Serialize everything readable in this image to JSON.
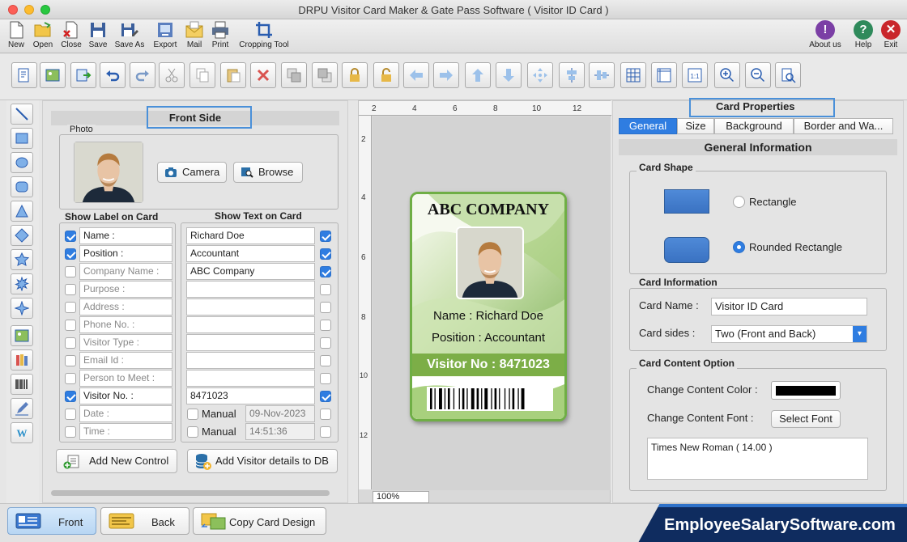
{
  "window": {
    "title": "DRPU Visitor Card Maker & Gate Pass Software ( Visitor ID Card )"
  },
  "toolbar": {
    "new": "New",
    "open": "Open",
    "close": "Close",
    "save": "Save",
    "save_as": "Save As",
    "export": "Export",
    "mail": "Mail",
    "print": "Print",
    "cropping_tool": "Cropping Tool",
    "about_us": "About us",
    "help": "Help",
    "exit": "Exit"
  },
  "front": {
    "title": "Front Side",
    "photo_group": "Photo",
    "camera": "Camera",
    "browse": "Browse",
    "label_header": "Show Label on Card",
    "text_header": "Show Text on Card",
    "rows": [
      {
        "label": "Name :",
        "label_checked": true,
        "text": "Richard Doe",
        "text_checked": true
      },
      {
        "label": "Position :",
        "label_checked": true,
        "text": "Accountant",
        "text_checked": true
      },
      {
        "label": "Company Name :",
        "label_checked": false,
        "text": "ABC Company",
        "text_checked": true
      },
      {
        "label": "Purpose :",
        "label_checked": false,
        "text": "",
        "text_checked": false
      },
      {
        "label": "Address :",
        "label_checked": false,
        "text": "",
        "text_checked": false
      },
      {
        "label": "Phone No. :",
        "label_checked": false,
        "text": "",
        "text_checked": false
      },
      {
        "label": "Visitor Type :",
        "label_checked": false,
        "text": "",
        "text_checked": false
      },
      {
        "label": "Email Id :",
        "label_checked": false,
        "text": "",
        "text_checked": false
      },
      {
        "label": "Person to Meet :",
        "label_checked": false,
        "text": "",
        "text_checked": false
      },
      {
        "label": "Visitor No. :",
        "label_checked": true,
        "text": "8471023",
        "text_checked": true
      }
    ],
    "date_label": "Date :",
    "time_label": "Time :",
    "manual": "Manual",
    "date_value": "09-Nov-2023",
    "time_value": "14:51:36",
    "add_control": "Add New Control",
    "add_visitor_db": "Add Visitor details to DB"
  },
  "canvas": {
    "zoom": "100%",
    "ruler_top": [
      "2",
      "4",
      "6",
      "8",
      "10",
      "12"
    ],
    "ruler_left": [
      "2",
      "4",
      "6",
      "8",
      "10",
      "12"
    ]
  },
  "card": {
    "company": "ABC COMPANY",
    "name_line": "Name : Richard Doe",
    "position_line": "Position :  Accountant",
    "visitor_line": "Visitor No :  8471023",
    "accent": "#7cae47"
  },
  "props": {
    "title": "Card Properties",
    "tabs": [
      "General",
      "Size",
      "Background",
      "Border and Wa..."
    ],
    "general_info": "General Information",
    "card_shape": "Card Shape",
    "rectangle": "Rectangle",
    "rounded_rectangle": "Rounded Rectangle",
    "card_information": "Card Information",
    "card_name_label": "Card Name :",
    "card_name_value": "Visitor ID Card",
    "card_sides_label": "Card sides :",
    "card_sides_value": "Two (Front and Back)",
    "content_option": "Card Content Option",
    "content_color_label": "Change Content Color :",
    "content_color": "#000000",
    "content_font_label": "Change Content Font :",
    "select_font": "Select Font",
    "font_value": "Times New Roman ( 14.00 )"
  },
  "bottom": {
    "front": "Front",
    "back": "Back",
    "copy_design": "Copy Card Design",
    "brand": "EmployeeSalarySoftware.com"
  }
}
